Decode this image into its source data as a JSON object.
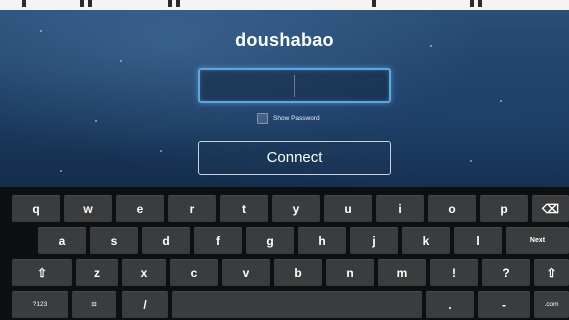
{
  "dialog": {
    "title": "doushabao",
    "password_value": "",
    "show_password_label": "Show Password",
    "connect_label": "Connect"
  },
  "keyboard": {
    "row1": [
      "q",
      "w",
      "e",
      "r",
      "t",
      "y",
      "u",
      "i",
      "o",
      "p"
    ],
    "row2": [
      "a",
      "s",
      "d",
      "f",
      "g",
      "h",
      "j",
      "k",
      "l"
    ],
    "row3": [
      "z",
      "x",
      "c",
      "v",
      "b",
      "n",
      "m",
      "!",
      "?"
    ],
    "next_label": "Next",
    "symbols_label": "?123",
    "slash_label": "/",
    "dotcom_label": ".com",
    "delete_glyph": "⌫",
    "shift_glyph": "⇧",
    "settings_glyph": "⌗",
    "period_label": ".",
    "dash_label": "-"
  },
  "colors": {
    "input_focus": "#5fa6e0",
    "key_bg": "#3a3c3e",
    "keyboard_bg": "#0e0f10"
  }
}
